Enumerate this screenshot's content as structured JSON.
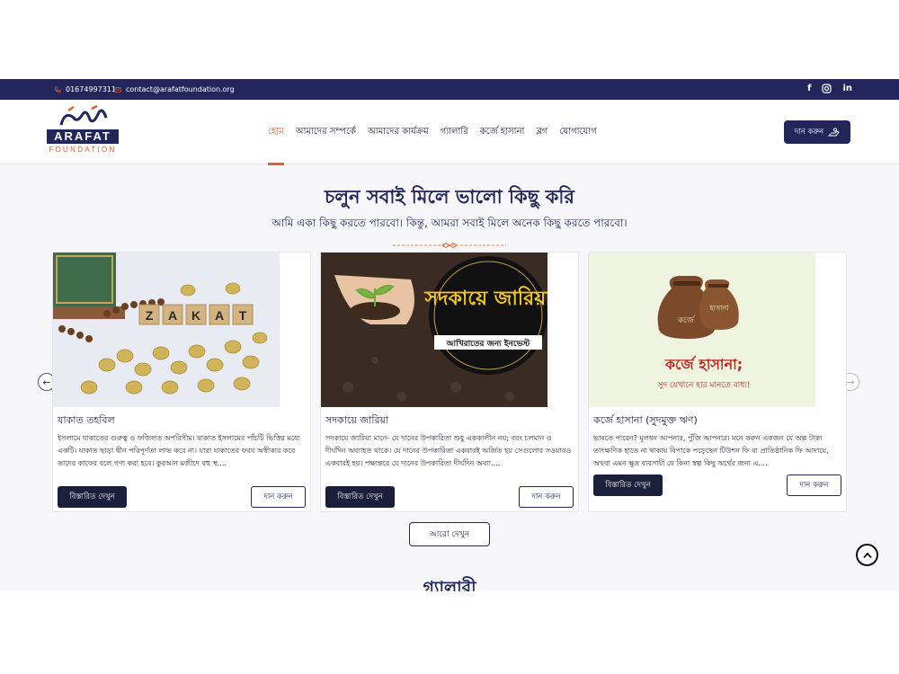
{
  "topbar": {
    "phone": "01674997311",
    "email": "contact@arafatfoundation.org",
    "social": [
      "facebook-icon",
      "instagram-icon",
      "linkedin-icon"
    ]
  },
  "logo": {
    "name": "ARAFAT",
    "sub": "FOUNDATION"
  },
  "nav": [
    "হোম",
    "আমাদের সম্পর্কে",
    "আমাদের কার্যক্রম",
    "গ্যালারি",
    "কর্জে হাসানা",
    "ব্লগ",
    "যোগাযোগ"
  ],
  "header": {
    "donate_label": "দান করুন"
  },
  "hero": {
    "title": "চলুন সবাই মিলে ভালো কিছু করি",
    "subtitle": "আমি একা কিছু করতে পারবো। কিন্তু, আমরা সবাই মিলে অনেক কিছু করতে পারবো।"
  },
  "cards": [
    {
      "img_text": "ZAKAT",
      "title": "যাকাত তহবিল",
      "desc": "ইসলামে যাকাতের গুরুত্ব ও ফজিলত অপরিসীম। যাকাত ইসলামের পাঁচটি ভিত্তির মধ্যে একটি। যাকাত ছাড়া দ্বীন পরিপূর্ণতা লাভ করে না। যারা যাকাতের ফরয অস্বীকার করে তাদের কাফের বলে গণ্য করা হবে। কুরআন মজীদে বহু স্থ....",
      "more_label": "বিস্তারিত দেখুন",
      "donate_label": "দান করুন"
    },
    {
      "img_text": "সদকায়ে জারিয়া",
      "img_subtext": "আখিরাতের জন্য ইনভেস্ট",
      "title": "সদকায়ে জারিয়া",
      "desc": "সদকায়ে জারিয়া মানে- যে দানের উপকারিতা শুধু এককালীন নয়; বরং চলমান ও দীর্ঘদিন অব্যাহত থাকে। যে দানের উপকারিতা একবারই অর্জিত হয় সেগুলোর সওয়াবও একবারই হয়। পক্ষান্তরে যে দানের উপকারিতা দীর্ঘদিন অব্যা....",
      "more_label": "বিস্তারিত দেখুন",
      "donate_label": "দান করুন"
    },
    {
      "img_bag1": "কর্জে",
      "img_bag2": "হাসানা",
      "img_text": "কর্জে হাসানা;",
      "img_subtext": "সুদ যেখানে হার মানতে বাধ্য!",
      "title": "কর্জে হাসানা (সুদমুক্ত ঋণ)",
      "desc": "ভাবতে পারেন? মূলধন আপনার, পুঁজি আপনার। মনে করুন একজন যে অল্প টাকা তাৎক্ষণিক হাতে না থাকায় বিপাকে পড়েছেন টিউশন ফি বা প্রাতিষ্ঠানিক ফি আদায়ে, অথবা এমন ক্ষুদ্র ব্যবসায়ী যে কিনা স্বল্প কিছু অর্থের জন্য এ....",
      "more_label": "বিস্তারিত দেখুন",
      "donate_label": "দান করুন"
    }
  ],
  "more_button": "আরো দেখুন",
  "gallery_title": "গ্যালারী",
  "colors": {
    "navy": "#23265a",
    "accent": "#e0622b",
    "dark_btn": "#1a1f3b"
  }
}
